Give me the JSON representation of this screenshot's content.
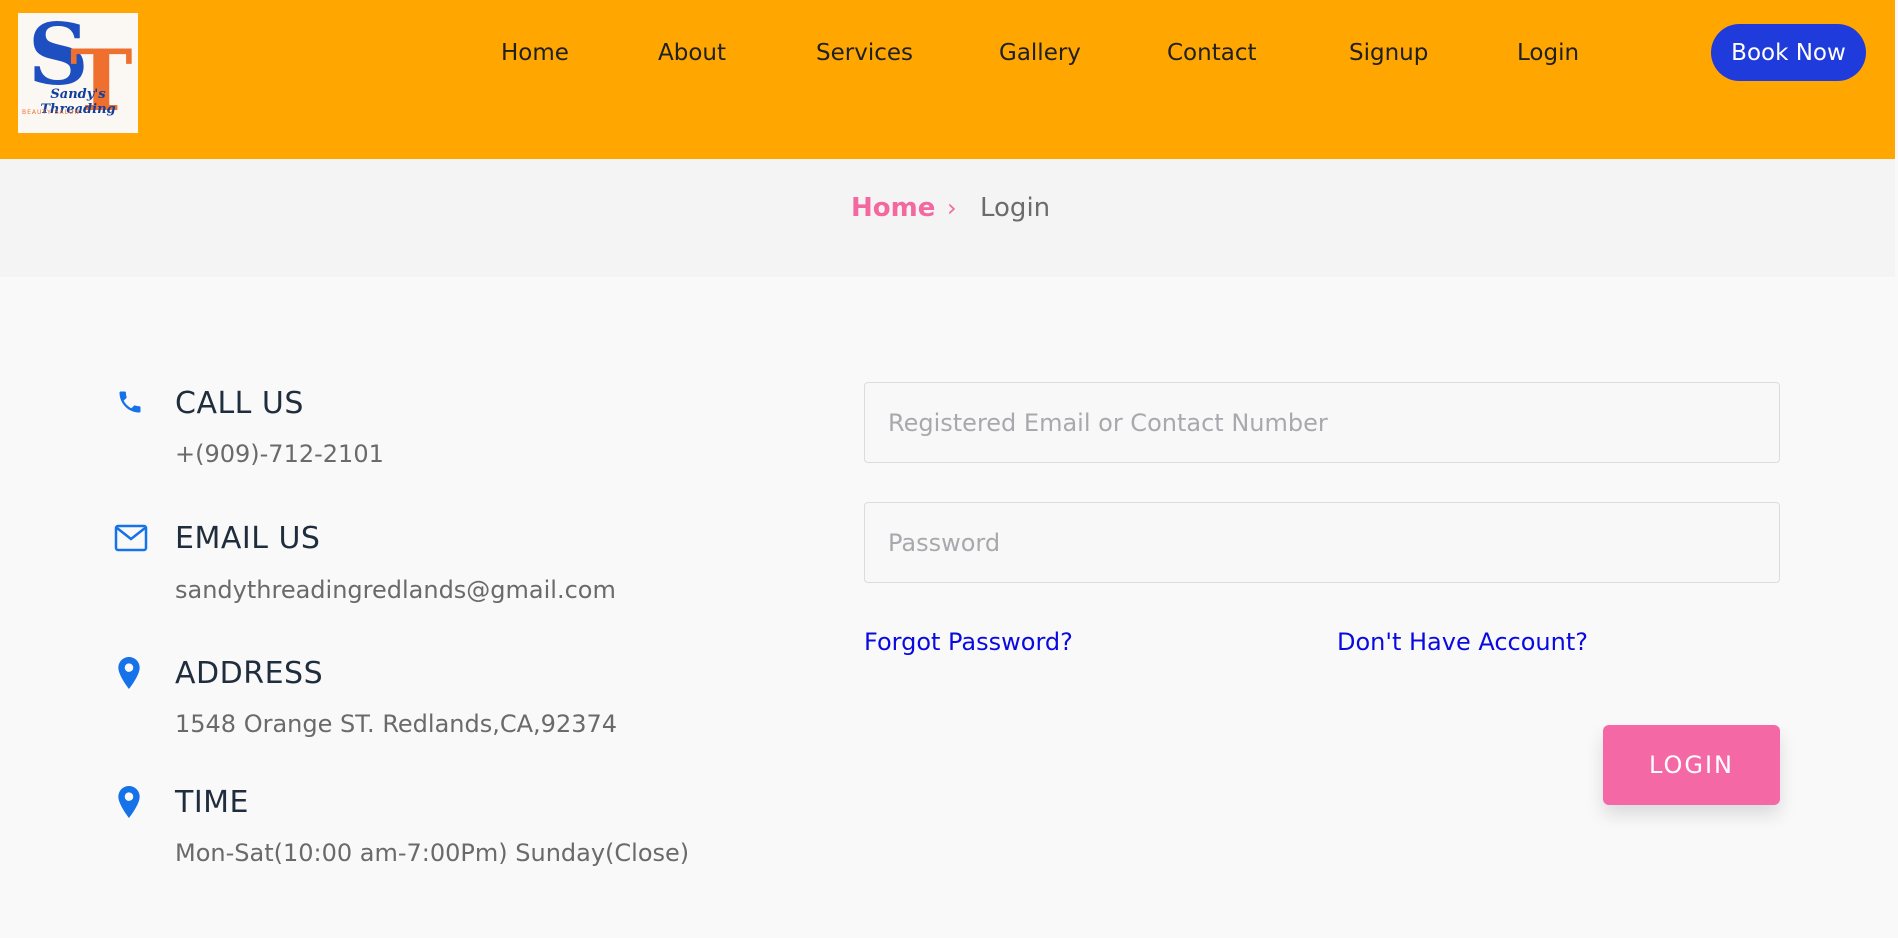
{
  "brand": {
    "logo_initials_s": "S",
    "logo_initials_t": "T",
    "logo_name": "Sandy's Threading",
    "logo_tagline": "BEAUTY SALON"
  },
  "nav": {
    "items": [
      "Home",
      "About",
      "Services",
      "Gallery",
      "Contact",
      "Signup",
      "Login"
    ],
    "cta_label": "Book Now"
  },
  "breadcrumb": {
    "home": "Home",
    "separator": "›",
    "current": "Login"
  },
  "contact": {
    "call_title": "CALL US",
    "call_value": "+(909)-712-2101",
    "email_title": "EMAIL US",
    "email_value": "sandythreadingredlands@gmail.com",
    "address_title": "ADDRESS",
    "address_value": "1548 Orange ST. Redlands,CA,92374",
    "time_title": "TIME",
    "time_value": "Mon-Sat(10:00 am-7:00Pm) Sunday(Close)"
  },
  "login_form": {
    "email_placeholder": "Registered Email or Contact Number",
    "email_value": "",
    "password_placeholder": "Password",
    "password_value": "",
    "forgot_link": "Forgot Password?",
    "signup_link": "Don't Have Account?",
    "submit_label": "LOGIN"
  },
  "colors": {
    "header_bg": "#ffa700",
    "cta_bg": "#1f3bdc",
    "accent_pink": "#f469a5",
    "icon_blue": "#1672e8",
    "link_blue": "#0a0ae0"
  },
  "icons": [
    "phone-icon",
    "mail-icon",
    "location-pin-icon",
    "time-pin-icon",
    "chevron-right-icon"
  ]
}
